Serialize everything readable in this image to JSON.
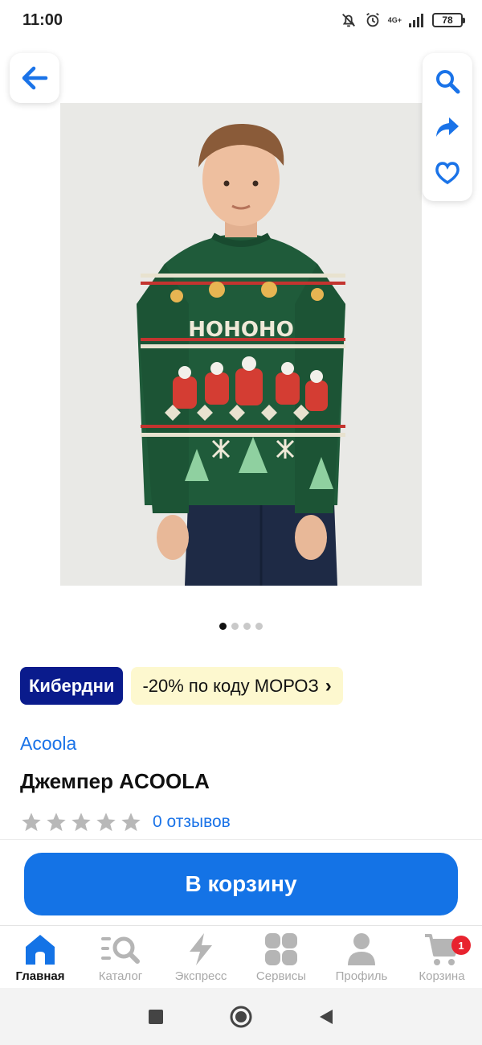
{
  "status_bar": {
    "time": "11:00",
    "network": "4G+",
    "battery": "78"
  },
  "carousel": {
    "count": 4,
    "active": 0
  },
  "badges": {
    "brand": "Кибердни",
    "promo": "-20% по коду МОРОЗ"
  },
  "product": {
    "brand": "Acoola",
    "title": "Джемпер ACOOLA",
    "rating": 0,
    "reviews": "0 отзывов",
    "sweater_text": "HOHOHO"
  },
  "cart_button": "В корзину",
  "bottom_nav": {
    "items": [
      {
        "label": "Главная",
        "icon": "home-icon",
        "active": true
      },
      {
        "label": "Каталог",
        "icon": "catalog-search-icon"
      },
      {
        "label": "Экспресс",
        "icon": "lightning-icon"
      },
      {
        "label": "Сервисы",
        "icon": "services-icon"
      },
      {
        "label": "Профиль",
        "icon": "profile-icon"
      },
      {
        "label": "Корзина",
        "icon": "cart-icon",
        "badge": "1"
      }
    ]
  },
  "colors": {
    "accent": "#1473e6",
    "brand_badge": "#0a1b8c",
    "promo_bg": "#fdf8cf",
    "link": "#1a73e8",
    "badge_red": "#e8232f"
  }
}
